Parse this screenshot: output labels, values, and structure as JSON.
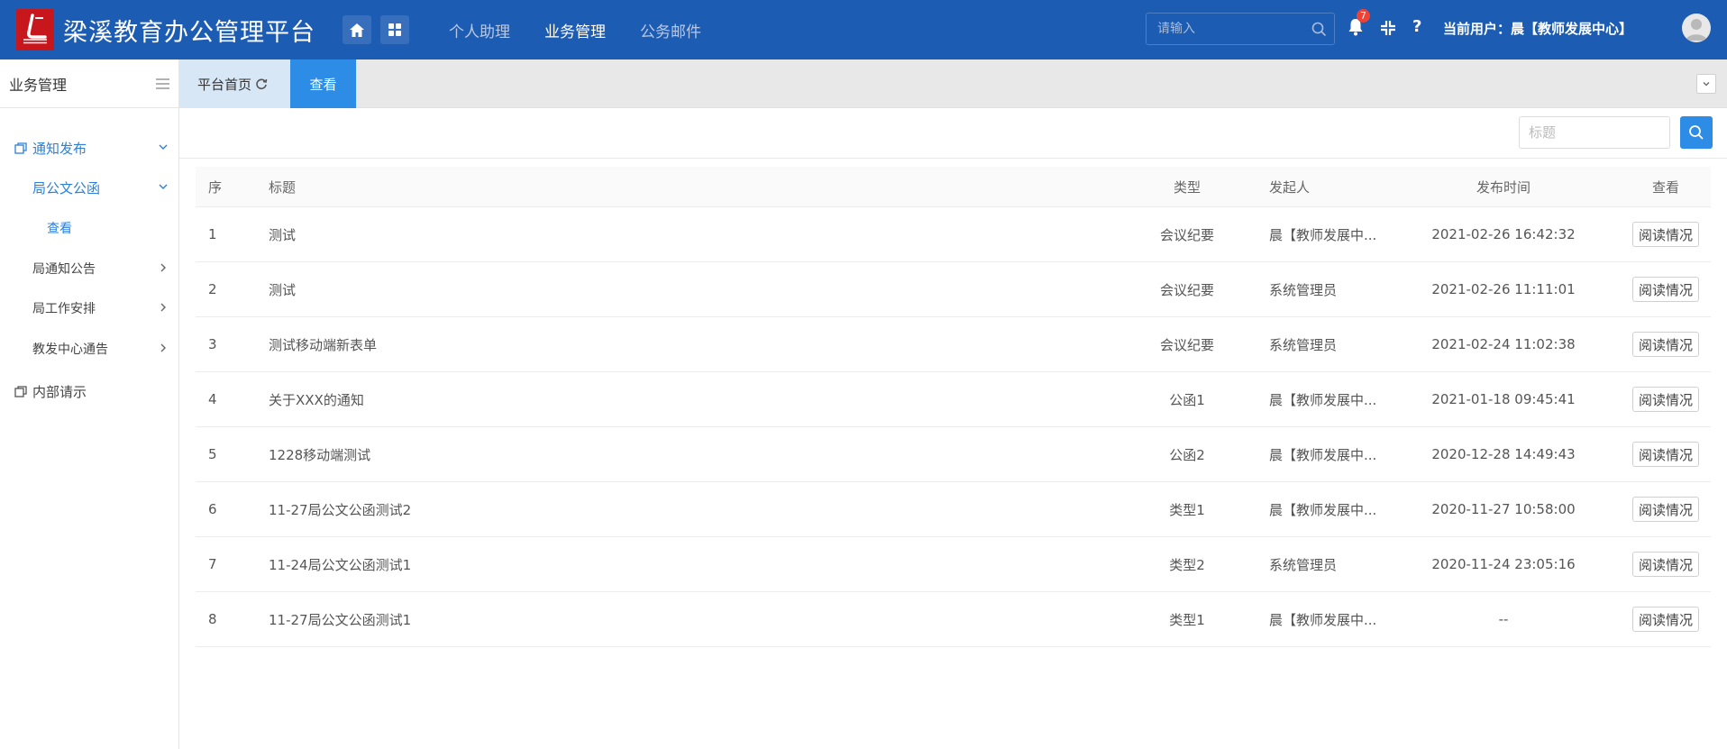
{
  "app": {
    "title": "梁溪教育办公管理平台"
  },
  "topnav": {
    "items": [
      {
        "label": "个人助理",
        "active": false
      },
      {
        "label": "业务管理",
        "active": true
      },
      {
        "label": "公务邮件",
        "active": false
      }
    ],
    "search_placeholder": "请输入",
    "notification_count": "7",
    "help_label": "?",
    "current_user": "当前用户：晨【教师发展中心】"
  },
  "sidebar": {
    "title": "业务管理",
    "items": [
      {
        "label": "通知发布",
        "level": 1,
        "state": "open",
        "active": true
      },
      {
        "label": "局公文公函",
        "level": 2,
        "state": "open",
        "active": true
      },
      {
        "label": "查看",
        "level": 3,
        "state": "selected",
        "active": true
      },
      {
        "label": "局通知公告",
        "level": 2,
        "state": "collapsed",
        "active": false
      },
      {
        "label": "局工作安排",
        "level": 2,
        "state": "collapsed",
        "active": false
      },
      {
        "label": "教发中心通告",
        "level": 2,
        "state": "collapsed",
        "active": false
      },
      {
        "label": "内部请示",
        "level": 1,
        "state": "leaf",
        "active": false
      }
    ]
  },
  "tabs": {
    "home": "平台首页",
    "view": "查看"
  },
  "filter": {
    "placeholder": "标题"
  },
  "table": {
    "headers": {
      "seq": "序",
      "title": "标题",
      "type": "类型",
      "from": "发起人",
      "time": "发布时间",
      "view": "查看"
    },
    "rows": [
      {
        "seq": "1",
        "title": "测试",
        "type": "会议纪要",
        "from": "晨【教师发展中...",
        "time": "2021-02-26 16:42:32",
        "action": "阅读情况"
      },
      {
        "seq": "2",
        "title": "测试",
        "type": "会议纪要",
        "from": "系统管理员",
        "time": "2021-02-26 11:11:01",
        "action": "阅读情况"
      },
      {
        "seq": "3",
        "title": "测试移动端新表单",
        "type": "会议纪要",
        "from": "系统管理员",
        "time": "2021-02-24 11:02:38",
        "action": "阅读情况"
      },
      {
        "seq": "4",
        "title": "关于XXX的通知",
        "type": "公函1",
        "from": "晨【教师发展中...",
        "time": "2021-01-18 09:45:41",
        "action": "阅读情况"
      },
      {
        "seq": "5",
        "title": "1228移动端测试",
        "type": "公函2",
        "from": "晨【教师发展中...",
        "time": "2020-12-28 14:49:43",
        "action": "阅读情况"
      },
      {
        "seq": "6",
        "title": "11-27局公文公函测试2",
        "type": "类型1",
        "from": "晨【教师发展中...",
        "time": "2020-11-27 10:58:00",
        "action": "阅读情况"
      },
      {
        "seq": "7",
        "title": "11-24局公文公函测试1",
        "type": "类型2",
        "from": "系统管理员",
        "time": "2020-11-24 23:05:16",
        "action": "阅读情况"
      },
      {
        "seq": "8",
        "title": "11-27局公文公函测试1",
        "type": "类型1",
        "from": "晨【教师发展中...",
        "time": "--",
        "action": "阅读情况"
      }
    ]
  },
  "colors": {
    "topbar": "#1d5cb3",
    "accent": "#2d8ce6",
    "sidebar_active": "#2d7fd8",
    "badge": "#f04134",
    "logo": "#c8161d"
  }
}
